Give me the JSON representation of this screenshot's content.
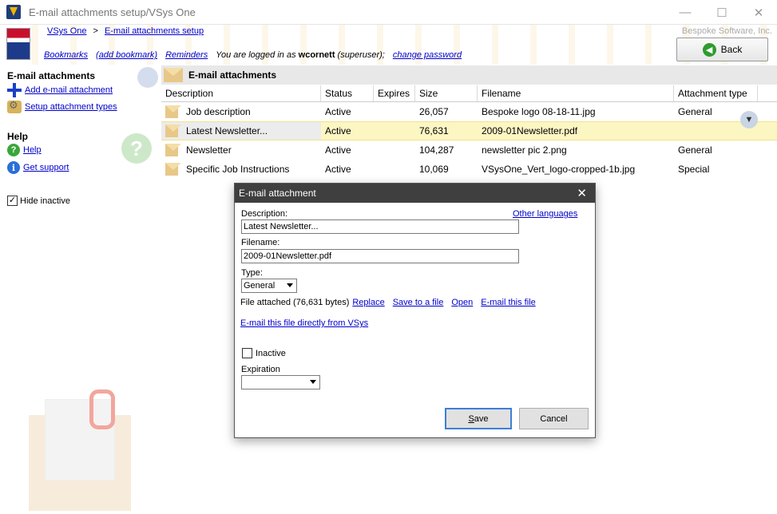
{
  "window": {
    "title": "E-mail attachments setup/VSys One",
    "controls": [
      "—",
      "☐",
      "✕"
    ]
  },
  "header": {
    "breadcrumb_root": "VSys One",
    "breadcrumb_sep": ">",
    "breadcrumb_current": "E-mail attachments setup",
    "vendor": "Bespoke Software, Inc.",
    "bookmarks": "Bookmarks",
    "add_bookmark": "(add bookmark)",
    "reminders": "Reminders",
    "logged_in_prefix": "You are logged in as",
    "username": "wcornett",
    "role": "(superuser);",
    "change_password": "change password",
    "back_label": "Back"
  },
  "sidebar": {
    "title": "E-mail attachments",
    "add_label": "Add e-mail attachment",
    "setup_label": "Setup attachment types",
    "help_title": "Help",
    "help_label": "Help",
    "support_label": "Get support",
    "hide_inactive_label": "Hide inactive",
    "hide_inactive_checked": true
  },
  "section": {
    "title": "E-mail attachments"
  },
  "table": {
    "columns": [
      "Description",
      "Status",
      "Expires",
      "Size",
      "Filename",
      "Attachment type"
    ],
    "rows": [
      {
        "description": "Job description",
        "status": "Active",
        "expires": "",
        "size": "26,057",
        "filename": "Bespoke logo 08-18-11.jpg",
        "type": "General"
      },
      {
        "description": "Latest Newsletter...",
        "status": "Active",
        "expires": "",
        "size": "76,631",
        "filename": "2009-01Newsletter.pdf",
        "type": ""
      },
      {
        "description": "Newsletter",
        "status": "Active",
        "expires": "",
        "size": "104,287",
        "filename": "newsletter pic 2.png",
        "type": "General"
      },
      {
        "description": "Specific Job Instructions",
        "status": "Active",
        "expires": "",
        "size": "10,069",
        "filename": "VSysOne_Vert_logo-cropped-1b.jpg",
        "type": "Special"
      }
    ]
  },
  "dialog": {
    "title": "E-mail attachment",
    "other_languages": "Other languages",
    "description_label": "Description:",
    "description_value": "Latest Newsletter...",
    "filename_label": "Filename:",
    "filename_value": "2009-01Newsletter.pdf",
    "type_label": "Type:",
    "type_value": "General",
    "file_attached": "File attached (76,631 bytes)",
    "replace": "Replace",
    "save_to_file": "Save to a file",
    "open": "Open",
    "email_file": "E-mail this file",
    "email_direct": "E-mail this file directly from VSys",
    "inactive_label": "Inactive",
    "expiration_label": "Expiration",
    "expiration_value": "",
    "save_label": "Save",
    "cancel_label": "Cancel"
  }
}
